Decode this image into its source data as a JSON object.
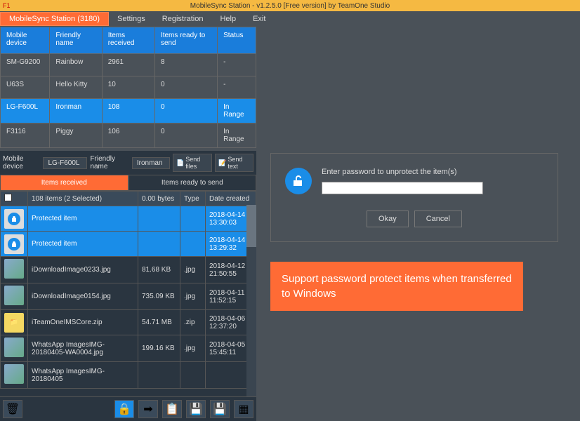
{
  "titlebar": {
    "close_label": "F1",
    "title": "MobileSync Station - v1.2.5.0 [Free version] by TeamOne Studio"
  },
  "menu": {
    "items": [
      {
        "label": "MobileSync Station (3180)",
        "active": true
      },
      {
        "label": "Settings",
        "active": false
      },
      {
        "label": "Registration",
        "active": false
      },
      {
        "label": "Help",
        "active": false
      },
      {
        "label": "Exit",
        "active": false
      }
    ]
  },
  "device_table": {
    "headers": [
      "Mobile device",
      "Friendly name",
      "Items received",
      "Items ready to send",
      "Status"
    ],
    "rows": [
      {
        "device": "SM-G9200",
        "name": "Rainbow",
        "received": "2961",
        "ready": "8",
        "status": "-",
        "selected": false
      },
      {
        "device": "U63S",
        "name": "Hello Kitty",
        "received": "10",
        "ready": "0",
        "status": "-",
        "selected": false
      },
      {
        "device": "LG-F600L",
        "name": "Ironman",
        "received": "108",
        "ready": "0",
        "status": "In Range",
        "selected": true
      },
      {
        "device": "F3116",
        "name": "Piggy",
        "received": "106",
        "ready": "0",
        "status": "In Range",
        "selected": false
      }
    ]
  },
  "device_bar": {
    "device_label": "Mobile device",
    "device_value": "LG-F600L",
    "name_label": "Friendly name",
    "name_value": "Ironman",
    "send_files": "Send files",
    "send_text": "Send text"
  },
  "tabs": {
    "received": "Items received",
    "ready": "Items ready to send"
  },
  "item_table": {
    "summary": "108 items (2 Selected)",
    "headers": {
      "size": "0.00 bytes",
      "type": "Type",
      "date": "Date created"
    },
    "rows": [
      {
        "name": "Protected item",
        "size": "",
        "type": "",
        "date": "2018-04-14 13:30:03",
        "selected": true,
        "icon": "lock"
      },
      {
        "name": "Protected item",
        "size": "",
        "type": "",
        "date": "2018-04-14 13:29:32",
        "selected": true,
        "icon": "lock"
      },
      {
        "name": "iDownloadImage0233.jpg",
        "size": "81.68 KB",
        "type": ".jpg",
        "date": "2018-04-12 21:50:55",
        "selected": false,
        "icon": "img"
      },
      {
        "name": "iDownloadImage0154.jpg",
        "size": "735.09 KB",
        "type": ".jpg",
        "date": "2018-04-11 11:52:15",
        "selected": false,
        "icon": "img"
      },
      {
        "name": "iTeamOneIMSCore.zip",
        "size": "54.71 MB",
        "type": ".zip",
        "date": "2018-04-06 12:37:20",
        "selected": false,
        "icon": "zip"
      },
      {
        "name": "WhatsApp ImagesIMG-20180405-WA0004.jpg",
        "size": "199.16 KB",
        "type": ".jpg",
        "date": "2018-04-05 15:45:11",
        "selected": false,
        "icon": "img"
      },
      {
        "name": "WhatsApp ImagesIMG-20180405",
        "size": "",
        "type": "",
        "date": "",
        "selected": false,
        "icon": "img"
      }
    ]
  },
  "dialog": {
    "prompt": "Enter password to unprotect the item(s)",
    "okay": "Okay",
    "cancel": "Cancel"
  },
  "callout": "Support password protect items when transferred to Windows"
}
